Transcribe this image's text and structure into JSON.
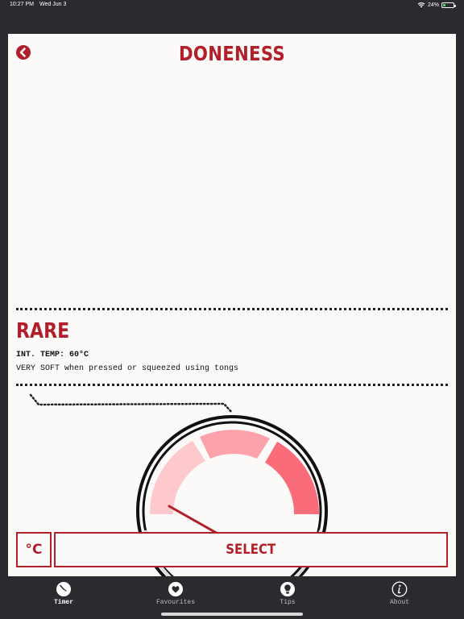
{
  "status_bar": {
    "time": "10:27 PM",
    "date": "Wed Jun 3",
    "battery": "24%"
  },
  "header": {
    "title": "DONENESS"
  },
  "doneness": {
    "name": "RARE",
    "int_temp": "INT. TEMP: 60°C",
    "description": "VERY SOFT when pressed or squeezed using tongs",
    "gauge_segment_colors": [
      "#fdc9cd",
      "#fca2ab",
      "#fb6c7a"
    ]
  },
  "actions": {
    "unit_label": "°C",
    "select_label": "SELECT"
  },
  "tabs": [
    {
      "label": "Timer",
      "icon": "clock-icon",
      "active": true
    },
    {
      "label": "Favourites",
      "icon": "heart-icon",
      "active": false
    },
    {
      "label": "Tips",
      "icon": "lightbulb-icon",
      "active": false
    },
    {
      "label": "About",
      "icon": "info-icon",
      "active": false
    }
  ],
  "colors": {
    "accent": "#b11f2b",
    "background": "#fbfaf8",
    "chrome": "#2b2a2f"
  }
}
